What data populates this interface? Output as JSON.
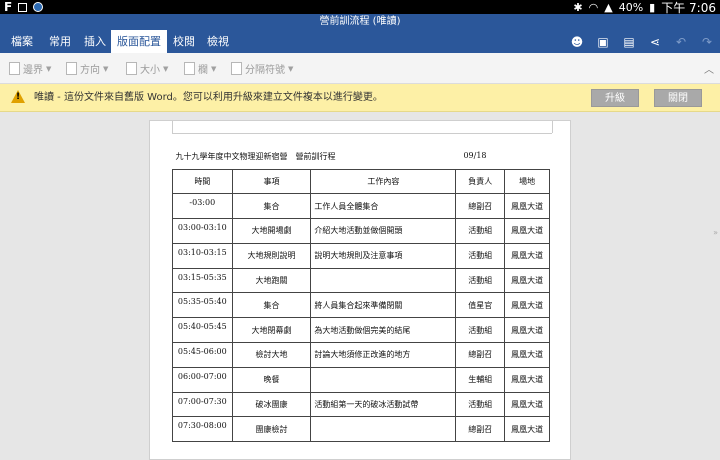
{
  "status_bar": {
    "app_letter": "F",
    "battery": "40%",
    "time": "下午 7:06"
  },
  "title_bar": {
    "title": "營前訓流程 (唯讀)"
  },
  "ribbon": {
    "tabs": [
      "檔案",
      "常用",
      "插入",
      "版面配置",
      "校閱",
      "檢視"
    ],
    "active_tab": "版面配置",
    "tools": [
      "smiley-icon",
      "save-icon",
      "reading-view-icon",
      "share-icon",
      "undo-icon",
      "redo-icon"
    ]
  },
  "toolbar": {
    "commands": [
      {
        "label": "邊界",
        "icon": "margins-icon"
      },
      {
        "label": "方向",
        "icon": "orientation-icon"
      },
      {
        "label": "大小",
        "icon": "size-icon"
      },
      {
        "label": "欄",
        "icon": "columns-icon"
      },
      {
        "label": "分隔符號",
        "icon": "breaks-icon"
      }
    ]
  },
  "message_bar": {
    "text": "唯讀 - 這份文件來自舊版 Word。您可以利用升級來建立文件複本以進行變更。",
    "upgrade_label": "升級",
    "dismiss_label": "關閉",
    "color": "#fdf0a6"
  },
  "document": {
    "title": "九十九學年度中文物理迎新宿營　營前訓行程",
    "date": "09/18",
    "headers": [
      "時間",
      "事項",
      "工作內容",
      "負責人",
      "場地"
    ],
    "rows": [
      {
        "time": "-03:00",
        "item": "集合",
        "content": "工作人員全體集合",
        "owner": "總副召",
        "place": "鳳凰大道"
      },
      {
        "time": "03:00-03:10",
        "item": "大地開場劇",
        "content": "介紹大地活動並做個開頭",
        "owner": "活動組",
        "place": "鳳凰大道"
      },
      {
        "time": "03:10-03:15",
        "item": "大地規則說明",
        "content": "說明大地規則及注意事項",
        "owner": "活動組",
        "place": "鳳凰大道"
      },
      {
        "time": "03:15-05:35",
        "item": "大地跑關",
        "content": "",
        "owner": "活動組",
        "place": "鳳凰大道"
      },
      {
        "time": "05:35-05:40",
        "item": "集合",
        "content": "將人員集合起來準備閉關",
        "owner": "值星官",
        "place": "鳳凰大道"
      },
      {
        "time": "05:40-05:45",
        "item": "大地閉幕劇",
        "content": "為大地活動做個完美的結尾",
        "owner": "活動組",
        "place": "鳳凰大道"
      },
      {
        "time": "05:45-06:00",
        "item": "檢討大地",
        "content": "討論大地須修正改進的地方",
        "owner": "總副召",
        "place": "鳳凰大道"
      },
      {
        "time": "06:00-07:00",
        "item": "晚餐",
        "content": "",
        "owner": "生輔組",
        "place": "鳳凰大道"
      },
      {
        "time": "07:00-07:30",
        "item": "破冰團康",
        "content": "活動組第一天的破冰活動試帶",
        "owner": "活動組",
        "place": "鳳凰大道"
      },
      {
        "time": "07:30-08:00",
        "item": "團康檢討",
        "content": "",
        "owner": "總副召",
        "place": "鳳凰大道"
      }
    ]
  }
}
